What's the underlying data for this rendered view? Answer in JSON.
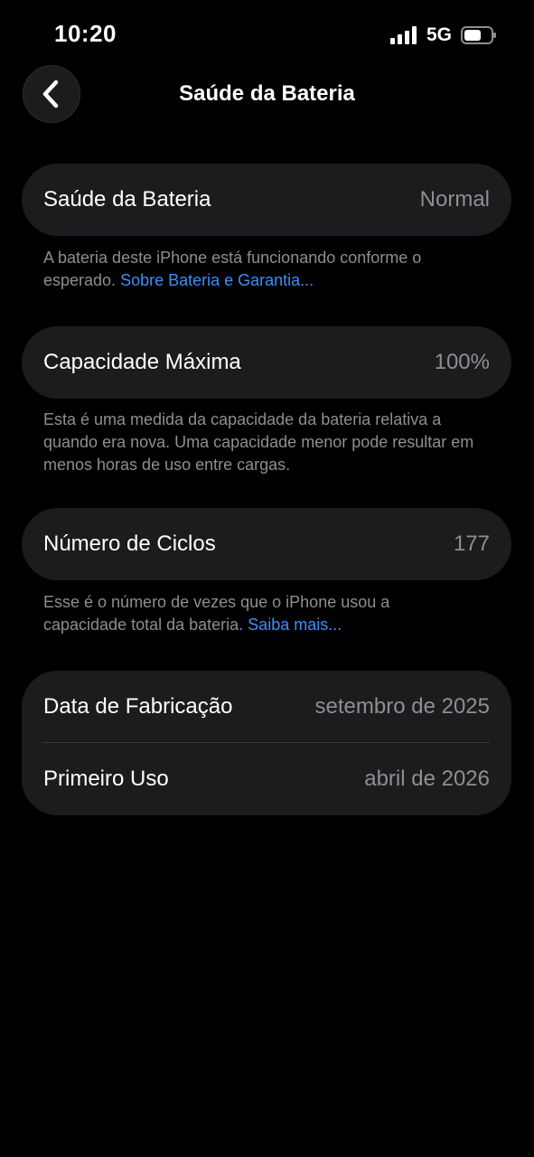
{
  "status_bar": {
    "time": "10:20",
    "network": "5G"
  },
  "header": {
    "title": "Saúde da Bateria"
  },
  "health": {
    "label": "Saúde da Bateria",
    "value": "Normal"
  },
  "health_note": {
    "text": "A bateria deste iPhone está funcionando conforme o esperado. ",
    "link": "Sobre Bateria e Garantia..."
  },
  "capacity": {
    "label": "Capacidade Máxima",
    "value": "100%"
  },
  "capacity_note": {
    "text": "Esta é uma medida da capacidade da bateria relativa a quando era nova. Uma capacidade menor pode resultar em menos horas de uso entre cargas."
  },
  "cycles": {
    "label": "Número de Ciclos",
    "value": "177"
  },
  "cycles_note": {
    "text": "Esse é o número de vezes que o iPhone usou a capacidade total da bateria. ",
    "link": "Saiba mais..."
  },
  "dates": {
    "manufacture_label": "Data de Fabricação",
    "manufacture_value": "setembro de 2025",
    "first_use_label": "Primeiro Uso",
    "first_use_value": "abril de 2026"
  },
  "colors": {
    "background": "#000000",
    "card": "#1c1c1e",
    "secondary_text": "#8e8e93",
    "link": "#3d8ff5"
  }
}
